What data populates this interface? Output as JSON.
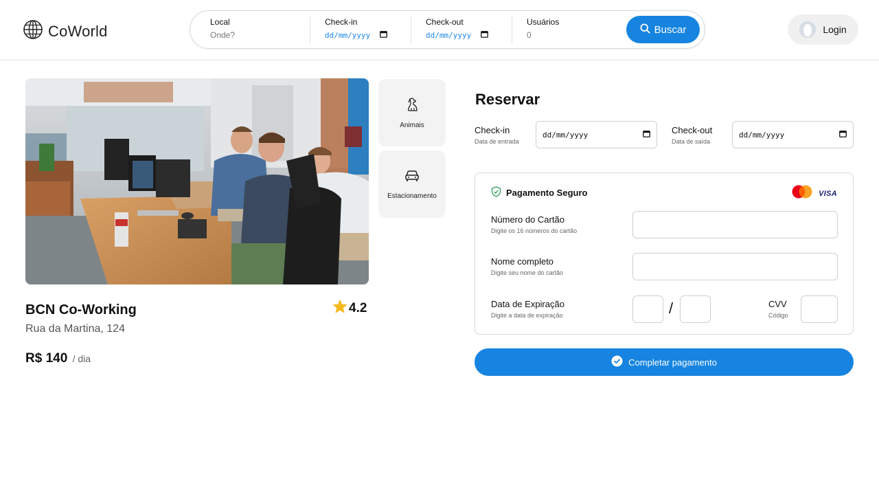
{
  "header": {
    "logo_text": "CoWorld",
    "search": {
      "local_label": "Local",
      "local_placeholder": "Onde?",
      "checkin_label": "Check-in",
      "checkin_placeholder": "dd/mm/yyyy",
      "checkout_label": "Check-out",
      "checkout_placeholder": "dd/mm/yyyy",
      "users_label": "Usuários",
      "users_value": "0",
      "button_label": "Buscar"
    },
    "login_label": "Login"
  },
  "listing": {
    "features": [
      {
        "label": "Animais",
        "icon": "dog-icon"
      },
      {
        "label": "Estacionamento",
        "icon": "car-icon"
      }
    ],
    "name": "BCN Co-Working",
    "rating": "4.2",
    "address": "Rua da Martina, 124",
    "price": "R$ 140",
    "price_unit": "/ dia"
  },
  "booking": {
    "title": "Reservar",
    "checkin_label": "Check-in",
    "checkin_sub": "Data de entrada",
    "checkin_placeholder": "dd/mm/yyyy",
    "checkout_label": "Check-out",
    "checkout_sub": "Data de saída",
    "checkout_placeholder": "dd/mm/yyyy",
    "payment": {
      "title": "Pagamento Seguro",
      "brands": [
        "mastercard",
        "VISA"
      ],
      "card_number_label": "Número do Cartão",
      "card_number_sub": "Digite os 16 números do cartão",
      "name_label": "Nome completo",
      "name_sub": "Digite seu nome do cartão",
      "expiry_label": "Data de Expiração",
      "expiry_sub": "Digite a data de expiração",
      "expiry_separator": "/",
      "cvv_label": "CVV",
      "cvv_sub": "Código"
    },
    "complete_button": "Completar pagamento"
  },
  "colors": {
    "accent": "#1684e0",
    "date_text": "#1e88e5",
    "secure_icon": "#2e9e5b",
    "star": "#f5b91f"
  }
}
